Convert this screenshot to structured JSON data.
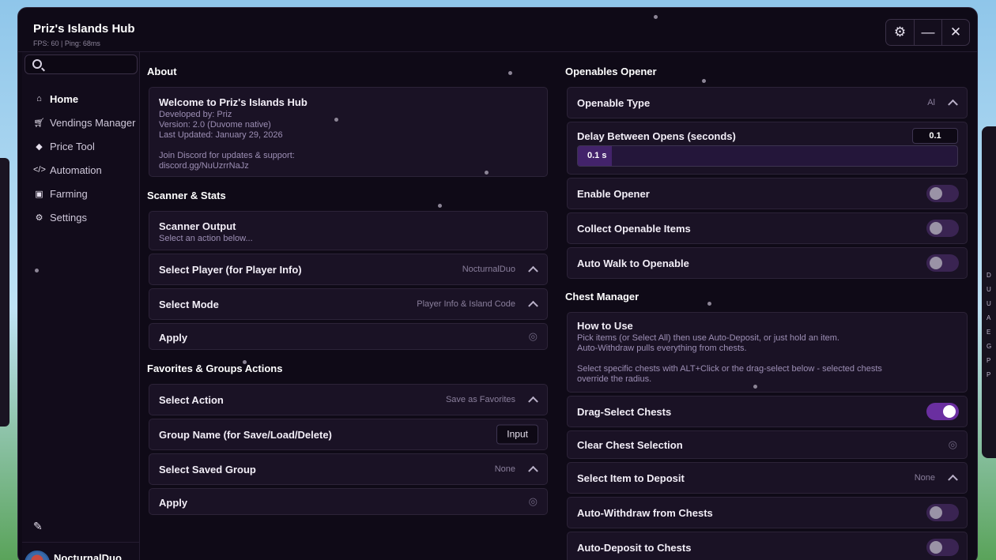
{
  "window": {
    "title": "Priz's Islands Hub",
    "stats": "FPS: 60  |  Ping: 68ms"
  },
  "search": {
    "placeholder": ""
  },
  "sidebar": {
    "items": [
      {
        "label": "Home",
        "icon": "home-icon",
        "active": true
      },
      {
        "label": "Vendings Manager",
        "icon": "cart-icon"
      },
      {
        "label": "Price Tool",
        "icon": "tag-icon"
      },
      {
        "label": "Automation",
        "icon": "code-icon"
      },
      {
        "label": "Farming",
        "icon": "lock-icon"
      },
      {
        "label": "Settings",
        "icon": "gear-icon"
      }
    ]
  },
  "user": {
    "name": "NocturnalDuo"
  },
  "left": {
    "about": {
      "heading": "About",
      "title": "Welcome to Priz's Islands Hub",
      "line1": "Developed by: Priz",
      "line2": "Version: 2.0 (Duvome native)",
      "line3": "Last Updated: January 29, 2026",
      "line4": "Join Discord for updates & support:",
      "line5": "discord.gg/NuUzrrNaJz"
    },
    "scanner": {
      "heading": "Scanner & Stats",
      "output_title": "Scanner Output",
      "output_text": "Select an action below...",
      "select_player_label": "Select Player (for Player Info)",
      "select_player_value": "NocturnalDuo",
      "select_mode_label": "Select Mode",
      "select_mode_value": "Player Info & Island Code",
      "apply_label": "Apply"
    },
    "favorites": {
      "heading": "Favorites & Groups Actions",
      "select_action_label": "Select Action",
      "select_action_value": "Save as Favorites",
      "group_name_label": "Group Name (for Save/Load/Delete)",
      "group_name_input": "Input",
      "saved_group_label": "Select Saved Group",
      "saved_group_value": "None",
      "apply_label": "Apply"
    }
  },
  "right": {
    "openables": {
      "heading": "Openables Opener",
      "type_label": "Openable Type",
      "type_value": "Al",
      "delay_label": "Delay Between Opens (seconds)",
      "delay_value": "0.1",
      "delay_slider_text": "0.1 s",
      "delay_fraction": 0.09,
      "enable_label": "Enable Opener",
      "enable_on": false,
      "collect_label": "Collect Openable Items",
      "collect_on": false,
      "walk_label": "Auto Walk to Openable",
      "walk_on": false
    },
    "chest": {
      "heading": "Chest Manager",
      "howto_title": "How to Use",
      "howto_line1": "Pick items (or Select All) then use Auto-Deposit, or just hold an item.",
      "howto_line2": "Auto-Withdraw pulls everything from chests.",
      "howto_line3": "Select specific chests with ALT+Click or the drag-select below - selected chests",
      "howto_line4": "override the radius.",
      "drag_label": "Drag-Select Chests",
      "drag_on": true,
      "clear_label": "Clear Chest Selection",
      "deposit_item_label": "Select Item to Deposit",
      "deposit_item_value": "None",
      "withdraw_label": "Auto-Withdraw from Chests",
      "withdraw_on": false,
      "deposit_label": "Auto-Deposit to Chests",
      "deposit_on": false
    }
  },
  "colors": {
    "accent": "#6a2fa0",
    "panel": "#1a1225",
    "background": "#0f0a17"
  },
  "background_panel_text": [
    "D",
    "U",
    "U",
    "A",
    "E",
    "G",
    "P",
    "P"
  ]
}
